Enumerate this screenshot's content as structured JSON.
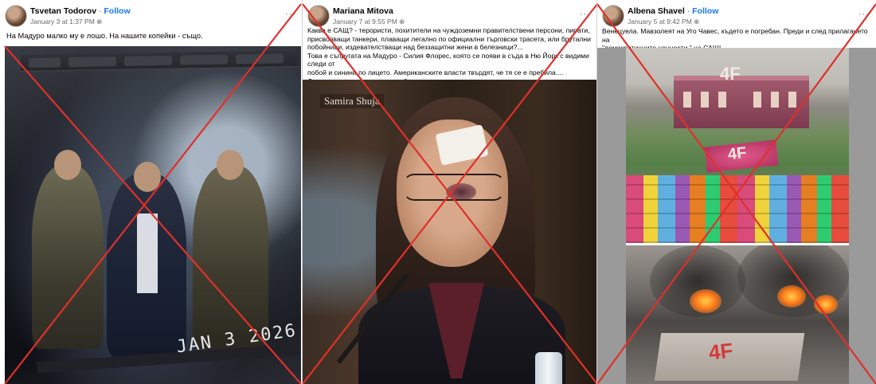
{
  "posts": [
    {
      "author": "Tsvetan Todorov",
      "follow": "Follow",
      "separator": " · ",
      "date": "January 3 at 1:37 PM",
      "more": "···",
      "text_lines": [
        "На Мадуро малко му е лошо.  На нашите копейки - също."
      ],
      "image_stamp": "JAN 3 2026"
    },
    {
      "author": "Mariana Mitova",
      "date": "January 7 at 9:55 PM",
      "more": "···",
      "text_lines": [
        "Каква е САЩ? - терористи, похитители на чуждоземни правителствени персони, пирати,",
        "присвояващи танкери, плаващи легално по официални  търговски трасета, или брутални",
        "побойници, издевателстващи над беззащитни жени в белезници?...",
        "Това е съпругата на Мадуро - Силия Флорес, която се появи в съда в Ню Йорк с видими следи от",
        "побой и синини по лицето. Американските власти твърдят, че тя се е пребила....",
        "Да, освен това и тъщи... открай време....откакто стъпиха на земята на индианците..."
      ],
      "image_caption": "Samira Shuja"
    },
    {
      "author": "Albena Shavel",
      "follow": "Follow",
      "separator": " · ",
      "date": "January 5 at 9:42 PM",
      "more": "···",
      "text_lines": [
        "Венецуела.  Мавзолеят  на  Уго  Чавес, където е погребан.  Преди  и след  прилагането  на",
        "\"демократичните ценности \" на  САЩ!"
      ],
      "image_logo_top": "4F",
      "image_logo_garden": "4F",
      "image_logo_bottom": "4F"
    }
  ],
  "colors": {
    "cross": "#e0302a",
    "follow": "#1877f2",
    "meta": "#65676b"
  },
  "icons": [
    "globe-icon",
    "more-options-icon"
  ]
}
